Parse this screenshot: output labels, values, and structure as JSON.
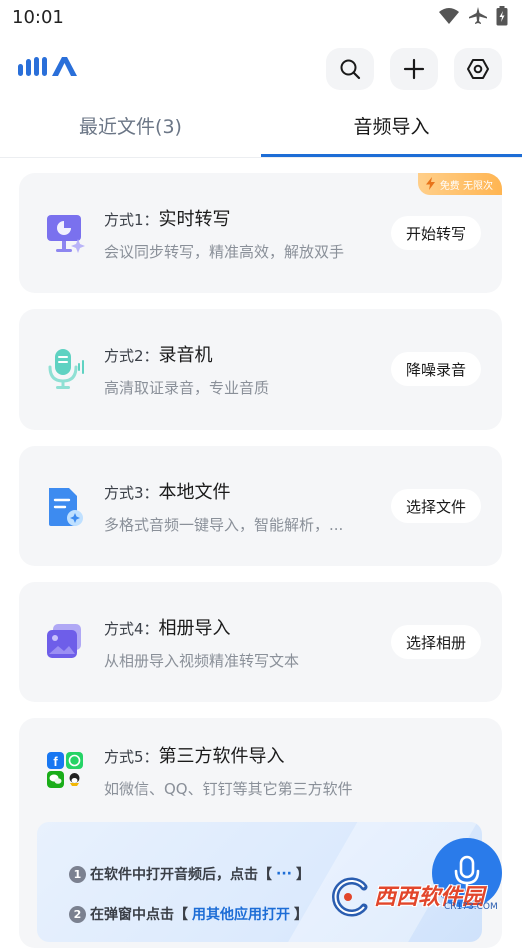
{
  "status_bar": {
    "time": "10:01"
  },
  "tabs": [
    {
      "label": "最近文件(3)",
      "active": false
    },
    {
      "label": "音频导入",
      "active": true
    }
  ],
  "badge": {
    "label": "免费 无限次"
  },
  "cards": [
    {
      "method": "方式1：",
      "title": "实时转写",
      "desc": "会议同步转写，精准高效，解放双手",
      "button": "开始转写",
      "icon": "presentation-icon"
    },
    {
      "method": "方式2：",
      "title": "录音机",
      "desc": "高清取证录音，专业音质",
      "button": "降噪录音",
      "icon": "microphone-icon"
    },
    {
      "method": "方式3：",
      "title": "本地文件",
      "desc": "多格式音频一键导入，智能解析，...",
      "button": "选择文件",
      "icon": "document-icon"
    },
    {
      "method": "方式4：",
      "title": "相册导入",
      "desc": "从相册导入视频精准转写文本",
      "button": "选择相册",
      "icon": "album-icon"
    },
    {
      "method": "方式5：",
      "title": "第三方软件导入",
      "desc": "如微信、QQ、钉钉等其它第三方软件",
      "icon": "third-party-apps-icon"
    }
  ],
  "guide": {
    "step1_prefix": "在软件中打开音频后，点击【",
    "step1_highlight": "···",
    "step1_suffix": "】",
    "step2_prefix": "在弹窗中点击【",
    "step2_highlight": "用其他应用打开",
    "step2_suffix": "】"
  },
  "watermark": {
    "brand": "西西软件园",
    "url": "CR173.COM"
  },
  "colors": {
    "accent": "#1d6dd6",
    "fab": "#2a7bea",
    "card_bg": "#f5f6f8",
    "badge": "#ffb552"
  }
}
